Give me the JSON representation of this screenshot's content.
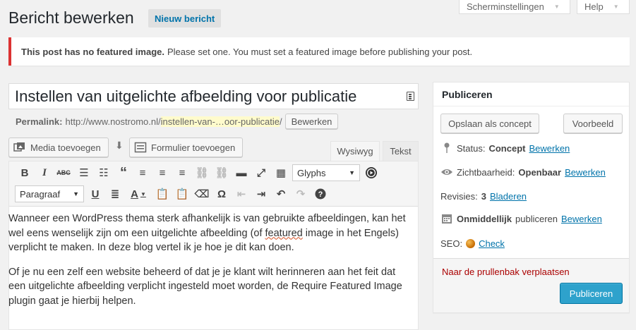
{
  "screen_meta": {
    "screen_options_label": "Scherminstellingen",
    "help_label": "Help"
  },
  "page": {
    "title": "Bericht bewerken",
    "add_new_label": "Nieuw bericht"
  },
  "notice": {
    "bold": "This post has no featured image.",
    "text": "Please set one. You must set a featured image before publishing your post."
  },
  "post_title": "Instellen van uitgelichte afbeelding voor publicatie",
  "permalink": {
    "label": "Permalink:",
    "base": "http://www.nostromo.nl/",
    "slug": "instellen-van-…oor-publicatie",
    "trailing": "/",
    "edit_label": "Bewerken"
  },
  "media_buttons": {
    "add_media": "Media toevoegen",
    "add_form": "Formulier toevoegen"
  },
  "editor_tabs": {
    "visual": "Wysiwyg",
    "text": "Tekst"
  },
  "toolbar": {
    "glyphs_select": "Glyphs",
    "format_select": "Paragraaf"
  },
  "content": {
    "p1_before": "Wanneer een WordPress thema sterk afhankelijk is van gebruikte afbeeldingen, kan het wel eens wenselijk zijn om een uitgelichte afbeelding (of ",
    "p1_squiggle": "featured",
    "p1_after": " image in het Engels) verplicht te maken. In deze blog vertel ik je hoe je dit kan doen.",
    "p2": "Of je nu een zelf een website beheerd of dat je je klant wilt herinneren aan het feit dat een uitgelichte afbeelding verplicht ingesteld moet worden, de Require Featured Image plugin gaat je hierbij helpen."
  },
  "publish": {
    "heading": "Publiceren",
    "save_draft": "Opslaan als concept",
    "preview": "Voorbeeld",
    "status_label": "Status:",
    "status_value": "Concept",
    "visibility_label": "Zichtbaarheid:",
    "visibility_value": "Openbaar",
    "revisions_label": "Revisies:",
    "revisions_count": "3",
    "revisions_link": "Bladeren",
    "schedule_bold": "Onmiddellijk",
    "schedule_text": "publiceren",
    "seo_label": "SEO:",
    "seo_link": "Check",
    "edit_link": "Bewerken",
    "trash_label": "Naar de prullenbak verplaatsen",
    "publish_label": "Publiceren"
  }
}
